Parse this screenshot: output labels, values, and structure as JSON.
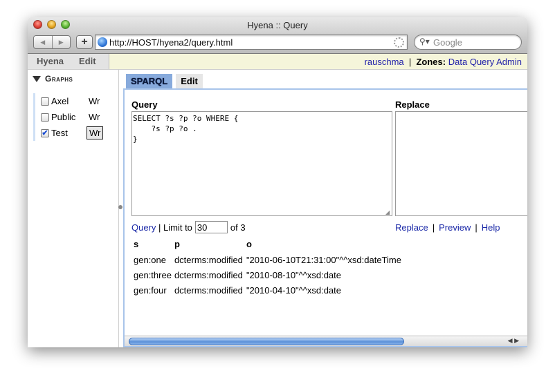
{
  "window": {
    "title": "Hyena :: Query"
  },
  "toolbar": {
    "back_icon": "◀",
    "forward_icon": "▶",
    "add_label": "+",
    "url": "http://HOST/hyena2/query.html",
    "search_placeholder": "Google"
  },
  "appbar": {
    "menu": [
      "Hyena",
      "Edit"
    ],
    "user": "rauschma",
    "zones_label": "Zones:",
    "zones": [
      "Data",
      "Query",
      "Admin"
    ]
  },
  "sidebar": {
    "heading": "Graphs",
    "graphs": [
      {
        "name": "Axel",
        "checked": false,
        "write": "Wr",
        "active": false
      },
      {
        "name": "Public",
        "checked": false,
        "write": "Wr",
        "active": false
      },
      {
        "name": "Test",
        "checked": true,
        "write": "Wr",
        "active": true
      }
    ]
  },
  "tabs": [
    "SPARQL",
    "Edit"
  ],
  "query": {
    "label": "Query",
    "text": "SELECT ?s ?p ?o WHERE {\n    ?s ?p ?o .\n}",
    "replace_label": "Replace",
    "run_link": "Query",
    "limit_label": "Limit to",
    "limit_value": "30",
    "of_text": "of 3",
    "actions": [
      "Replace",
      "Preview",
      "Help"
    ]
  },
  "results": {
    "columns": [
      "s",
      "p",
      "o"
    ],
    "rows": [
      [
        "gen:one",
        "dcterms:modified",
        "\"2010-06-10T21:31:00\"^^xsd:dateTime"
      ],
      [
        "gen:three",
        "dcterms:modified",
        "\"2010-08-10\"^^xsd:date"
      ],
      [
        "gen:four",
        "dcterms:modified",
        "\"2010-04-10\"^^xsd:date"
      ]
    ]
  }
}
